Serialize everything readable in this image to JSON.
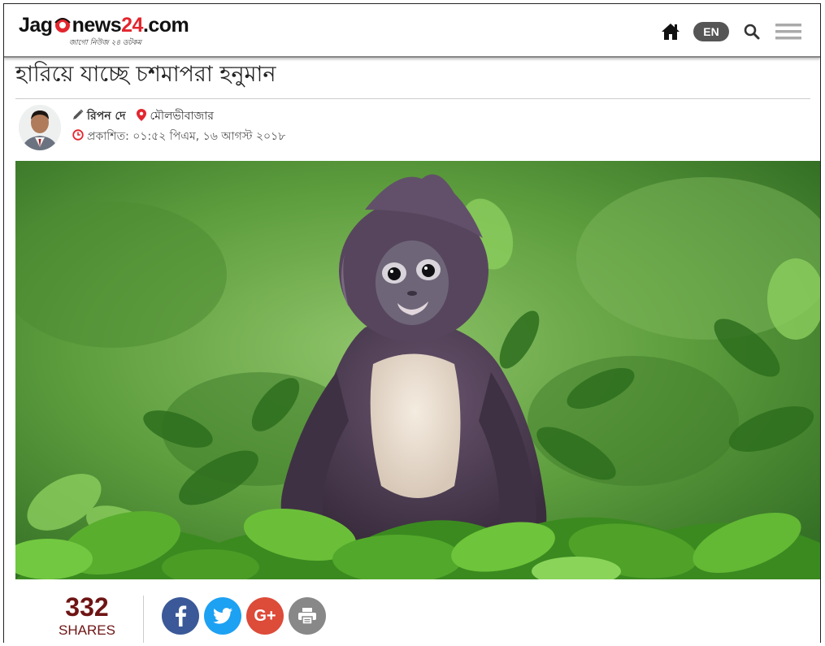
{
  "header": {
    "logo": {
      "jago": "Jag",
      "news": "news",
      "num": "24",
      "domain": ".com",
      "tagline": "জাগো নিউজ ২৪ ডটকম"
    },
    "nav": {
      "home_icon": "home-icon",
      "lang_label": "EN",
      "search_icon": "search-icon",
      "menu_icon": "hamburger-menu-icon"
    }
  },
  "article": {
    "headline": "হারিয়ে যাচ্ছে চশমাপরা হনুমান",
    "author": "রিপন দে",
    "location": "মৌলভীবাজার",
    "published": "প্রকাশিত: ০১:৫২ পিএম, ১৬ আগস্ট ২০১৮"
  },
  "share": {
    "count": "332",
    "label": "SHARES",
    "icons": [
      {
        "name": "facebook-icon",
        "glyph": "f",
        "color": "#3b5998"
      },
      {
        "name": "twitter-icon",
        "glyph": "",
        "color": "#1da1f2"
      },
      {
        "name": "google-plus-icon",
        "glyph": "G+",
        "color": "#dd4b39"
      },
      {
        "name": "print-icon",
        "glyph": "",
        "color": "#888888"
      }
    ]
  },
  "colors": {
    "accent_red": "#e3262e",
    "share_count": "#6e1414"
  }
}
